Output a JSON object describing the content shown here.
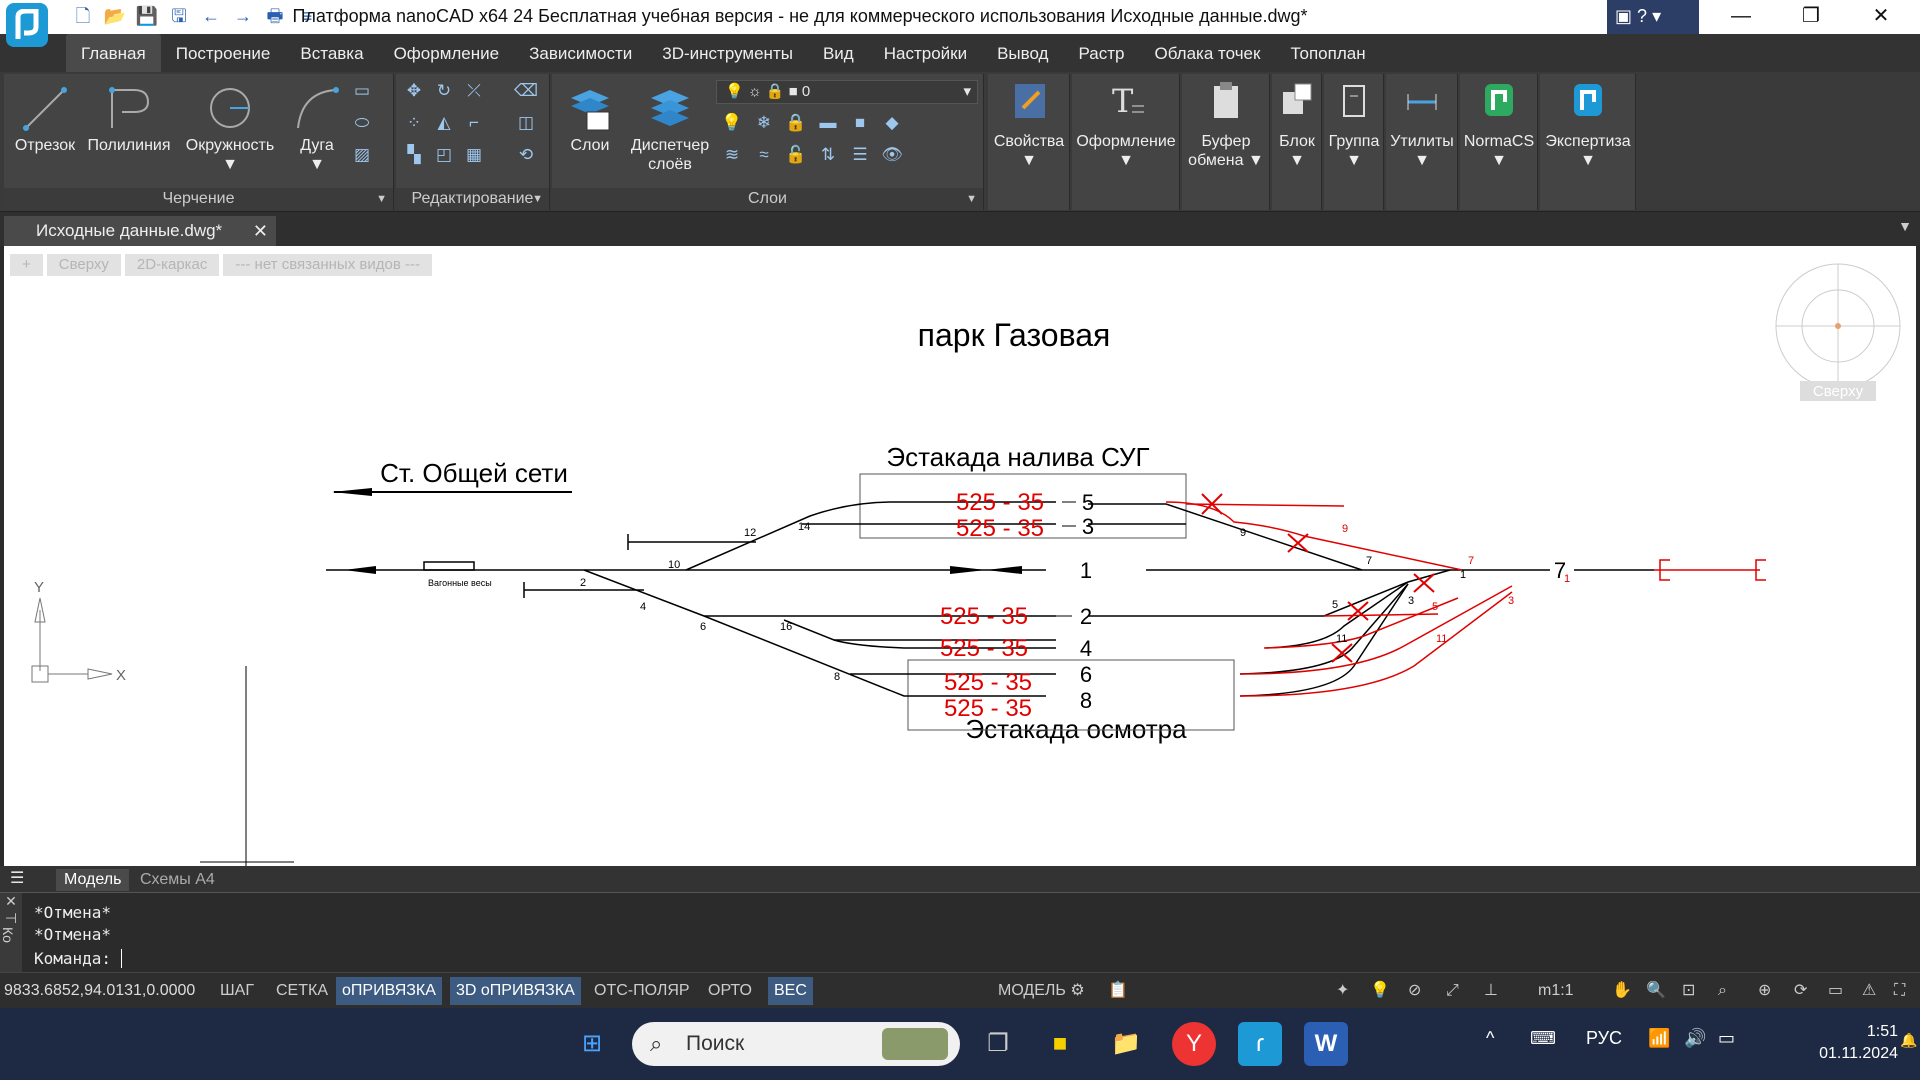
{
  "window": {
    "title": "Платформа nanoCAD x64 24  Бесплатная учебная версия - не для коммерческого использования Исходные данные.dwg*",
    "help": "?"
  },
  "menu_tabs": [
    "Главная",
    "Построение",
    "Вставка",
    "Оформление",
    "Зависимости",
    "3D-инструменты",
    "Вид",
    "Настройки",
    "Вывод",
    "Растр",
    "Облака точек",
    "Топоплан"
  ],
  "ribbon": {
    "draw": {
      "label": "Черчение",
      "items": [
        "Отрезок",
        "Полилиния",
        "Окружность",
        "Дуга"
      ]
    },
    "edit": {
      "label": "Редактирование"
    },
    "layers": {
      "label": "Слои",
      "items": [
        "Слои",
        "Диспетчер",
        "слоёв"
      ],
      "current_layer": "0"
    },
    "big": [
      "Свойства",
      "Оформление",
      "Буфер",
      "обмена",
      "Блок",
      "Группа",
      "Утилиты",
      "NormaCS",
      "Экспертиза"
    ]
  },
  "document": {
    "tab": "Исходные данные.dwg*"
  },
  "viewport": {
    "controls": [
      "+",
      "Сверху",
      "2D-каркас",
      "--- нет связанных видов ---"
    ],
    "cube_label": "Сверху",
    "ucs_x": "X",
    "ucs_y": "Y"
  },
  "drawing": {
    "title": "парк Газовая",
    "direction": "Ст. Общей сети",
    "platform_top": "Эстакада налива СУГ",
    "platform_bottom": "Эстакада осмотра",
    "scale_label": "Вагонные весы",
    "lengths": [
      "525 - 35",
      "525 - 35",
      "525 - 35",
      "525 - 35",
      "525 - 35",
      "525 - 35"
    ],
    "tracks": [
      "5",
      "3",
      "1",
      "2",
      "4",
      "6",
      "8",
      "7"
    ],
    "switches": [
      "12",
      "14",
      "10",
      "2",
      "4",
      "6",
      "16",
      "8",
      "9",
      "7",
      "5",
      "3",
      "11",
      "9",
      "7",
      "1",
      "5",
      "11",
      "3",
      "1"
    ]
  },
  "layout_tabs": [
    "Модель",
    "Схемы А4"
  ],
  "command": {
    "lines": [
      "*Отмена*",
      "*Отмена*"
    ],
    "prompt": "Команда:",
    "side": [
      "Ко"
    ]
  },
  "status": {
    "coords": "9833.6852,94.0131,0.0000",
    "buttons": [
      "ШАГ",
      "СЕТКА",
      "оПРИВЯЗКА",
      "3D оПРИВЯЗКА",
      "ОТС-ПОЛЯР",
      "ОРТО",
      "ВЕС"
    ],
    "model": "МОДЕЛЬ",
    "scale": "m1:1"
  },
  "taskbar": {
    "search": "Поиск",
    "lang": "РУС",
    "time": "1:51",
    "date": "01.11.2024"
  },
  "colors": {
    "accent": "#3d5a80",
    "red_track": "#e00000",
    "app_blue": "#1d9ad6"
  }
}
